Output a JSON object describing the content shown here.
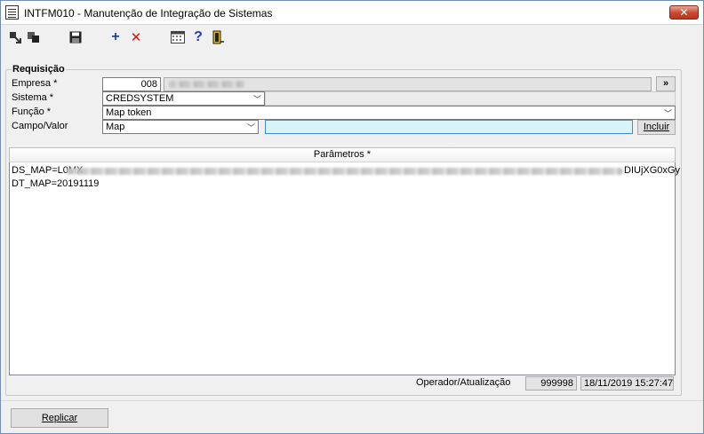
{
  "window": {
    "title": "INTFM010 - Manutenção de Integração de Sistemas",
    "close_label": "✕"
  },
  "toolbar": {
    "icons": [
      "select-icon",
      "copy-icon",
      "save-icon",
      "add-icon",
      "delete-icon",
      "calendar-icon",
      "help-icon",
      "exit-icon"
    ]
  },
  "requisicao": {
    "group_title": "Requisição",
    "empresa_label": "Empresa *",
    "empresa_code": "008",
    "more_button": "»",
    "sistema_label": "Sistema *",
    "sistema_value": "CREDSYSTEM",
    "funcao_label": "Função *",
    "funcao_value": "Map token",
    "campo_label": "Campo/Valor",
    "campo_value": "Map",
    "valor_value": "",
    "incluir_button": "Incluir"
  },
  "parametros": {
    "header": "Parâmetros *",
    "line1_start": "DS_MAP=L0MX",
    "line1_end": "DIUjXG0xGy",
    "line2": "DT_MAP=20191119"
  },
  "status": {
    "operador_label": "Operador/Atualização",
    "operador_value": "999998",
    "timestamp": "18/11/2019 15:27:47"
  },
  "footer": {
    "replicar_button": "Replicar"
  },
  "colors": {
    "accent_input": "#d9f3fb",
    "close_red": "#c9462c",
    "add_blue": "#1e3fae",
    "delete_red": "#d01818"
  }
}
